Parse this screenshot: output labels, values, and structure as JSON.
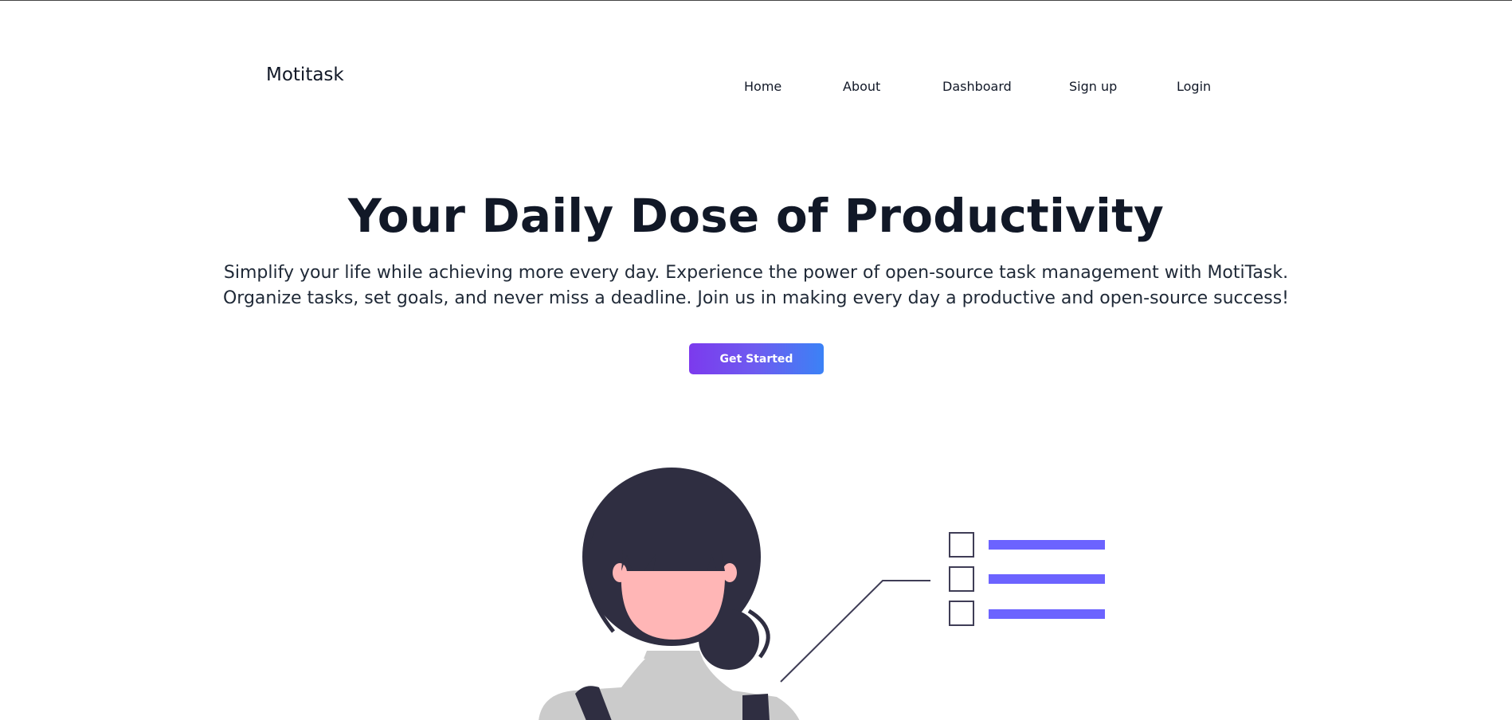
{
  "brand": {
    "name": "Motitask"
  },
  "nav": {
    "items": [
      {
        "label": "Home"
      },
      {
        "label": "About"
      },
      {
        "label": "Dashboard"
      },
      {
        "label": "Sign up"
      },
      {
        "label": "Login"
      }
    ]
  },
  "hero": {
    "title": "Your Daily Dose of Productivity",
    "subtitle": "Simplify your life while achieving more every day. Experience the power of open-source task management with MotiTask. Organize tasks, set goals, and never miss a deadline. Join us in making every day a productive and open-source success!",
    "cta_label": "Get Started"
  },
  "colors": {
    "text": "#111827",
    "cta_gradient_start": "#7c3aed",
    "cta_gradient_end": "#3b82f6",
    "hair": "#2f2e41",
    "skin": "#ffb6b6",
    "shirt": "#cbcbcb",
    "checklist_bar": "#6c63ff"
  },
  "illustration": {
    "icons": [
      "woman-figure",
      "checklist-icon"
    ]
  }
}
